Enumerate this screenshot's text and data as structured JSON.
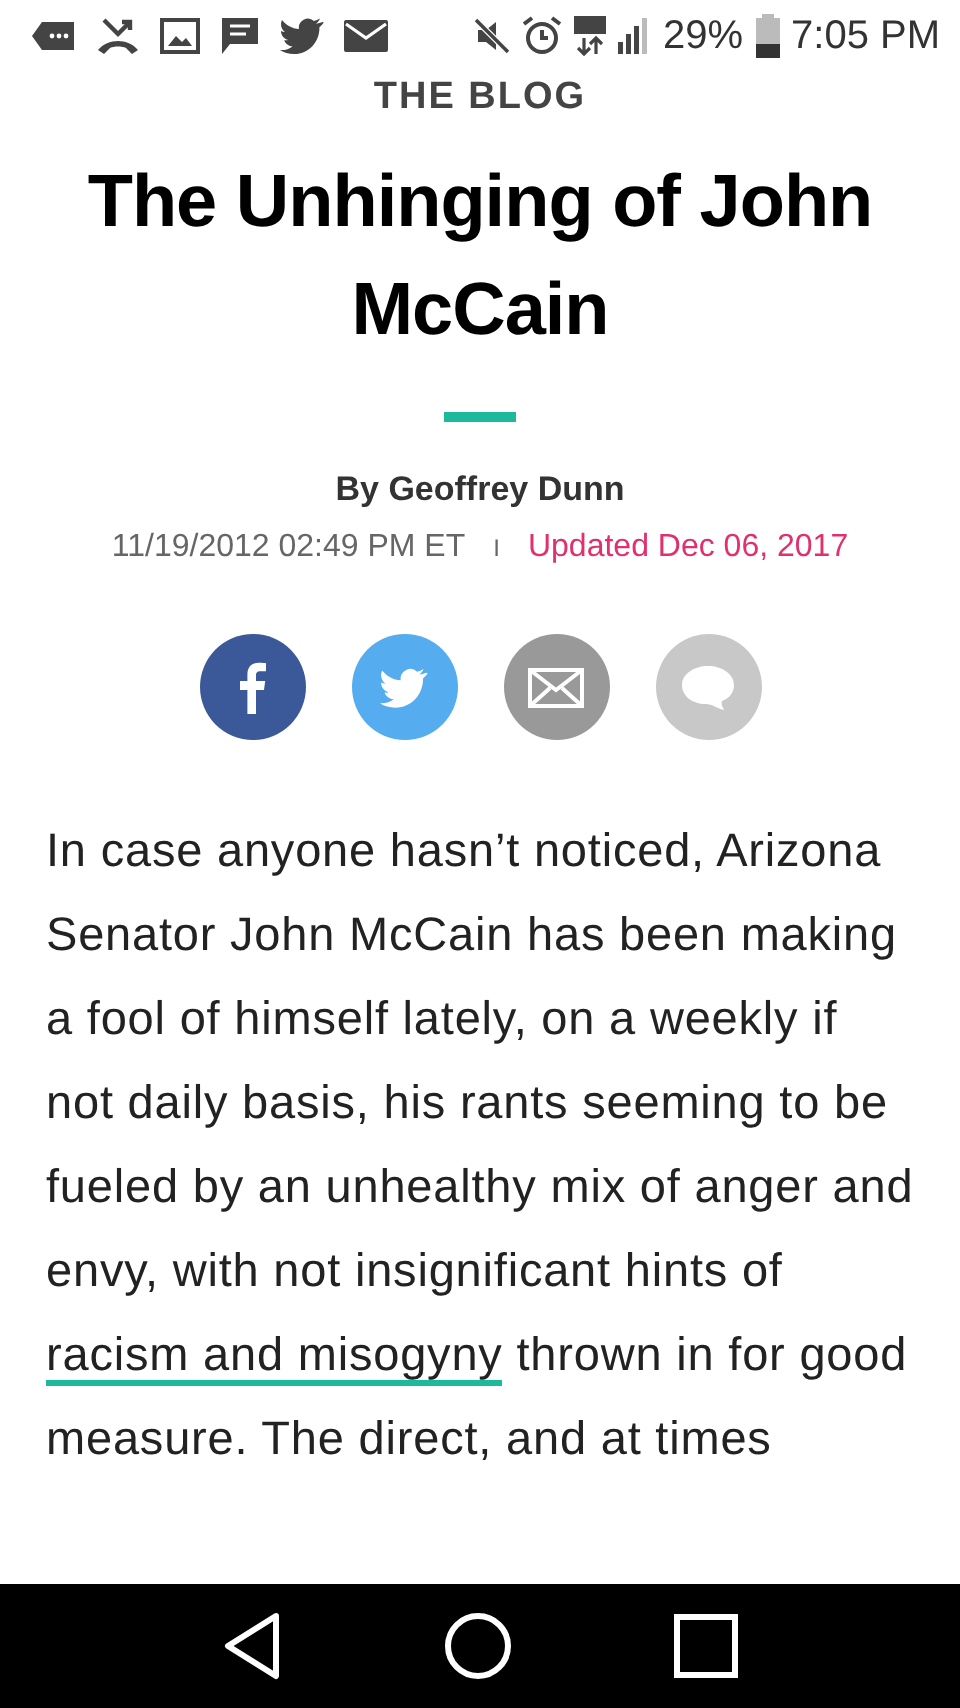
{
  "status_bar": {
    "battery": "29%",
    "time": "7:05 PM"
  },
  "section": "THE BLOG",
  "title": "The Unhinging of John McCain",
  "byline": "By Geoffrey Dunn",
  "date": "11/19/2012 02:49 PM ET",
  "separator": "I",
  "updated": "Updated Dec 06, 2017",
  "share_buttons": [
    {
      "kind": "facebook"
    },
    {
      "kind": "twitter"
    },
    {
      "kind": "email"
    },
    {
      "kind": "comment"
    }
  ],
  "body": [
    {
      "kind": "text",
      "text": "In case anyone hasn’t noticed, Arizona Senator John McCain has been making a fool of himself lately, on a weekly if not daily basis, his rants seeming to be fueled by an unhealthy mix of anger and envy, with not insignificant hints of "
    },
    {
      "kind": "link",
      "text": "racism and misogyny"
    },
    {
      "kind": "text",
      "text": " thrown in for good measure. The direct, and at times"
    }
  ]
}
